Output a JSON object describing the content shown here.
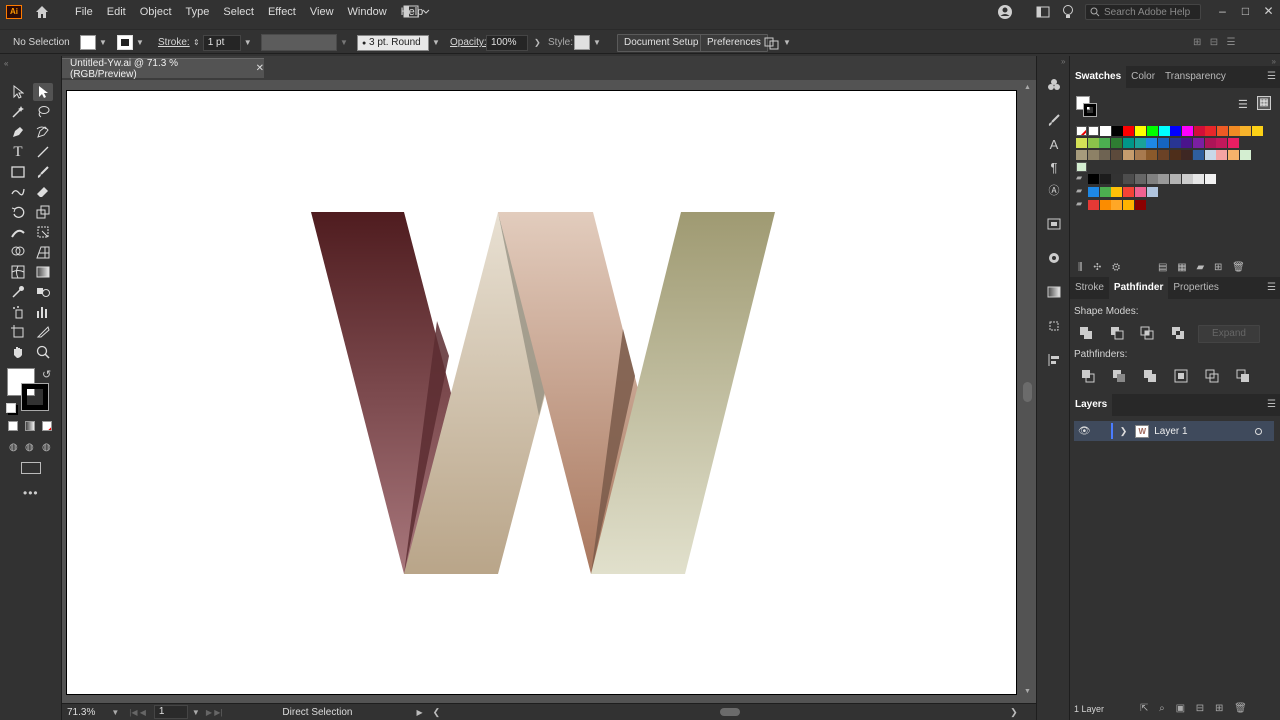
{
  "app": {
    "logo_text": "Ai"
  },
  "menu": {
    "items": [
      "File",
      "Edit",
      "Object",
      "Type",
      "Select",
      "Effect",
      "View",
      "Window",
      "Help"
    ]
  },
  "search": {
    "placeholder": "Search Adobe Help"
  },
  "controlbar": {
    "selection": "No Selection",
    "stroke_label": "Stroke:",
    "stroke_value": "1 pt",
    "brush_value": "3 pt. Round",
    "opacity_label": "Opacity:",
    "opacity_value": "100%",
    "style_label": "Style:",
    "document_setup": "Document Setup",
    "preferences": "Preferences"
  },
  "document": {
    "tab_title": "Untitled-Yw.ai @ 71.3 % (RGB/Preview)",
    "close": "✕"
  },
  "statusbar": {
    "zoom": "71.3%",
    "artboard_num": "1",
    "tool": "Direct Selection"
  },
  "panels": {
    "top_tabs": [
      "Swatches",
      "Color",
      "Transparency"
    ],
    "mid_tabs": [
      "Stroke",
      "Pathfinder",
      "Properties"
    ],
    "shape_modes_label": "Shape Modes:",
    "expand_label": "Expand",
    "pathfinders_label": "Pathfinders:",
    "layers_tab": "Layers",
    "layer_name": "Layer 1",
    "layers_count": "1 Layer"
  },
  "swatch_colors": {
    "row1": [
      "#ffffff",
      "#000000",
      "#ff0000",
      "#ffff00",
      "#00ff00",
      "#00ffff",
      "#0000ff",
      "#ff00ff",
      "#d20f38",
      "#e8262a",
      "#ee5a24",
      "#f08a24",
      "#f7b32b",
      "#fcd116"
    ],
    "row2": [
      "#d4e157",
      "#8bc34a",
      "#4caf50",
      "#2e7d32",
      "#009688",
      "#1aa39a",
      "#1e88e5",
      "#1565c0",
      "#283593",
      "#4a148c",
      "#7b1fa2",
      "#ad1457",
      "#c2185b",
      "#e91e63"
    ],
    "row3": [
      "#a69b7c",
      "#8d8166",
      "#6e6352",
      "#5c4a3b",
      "#c69c6d",
      "#a87a4f",
      "#8b5a2b",
      "#6b4226",
      "#4e2e1a",
      "#3e2723",
      "#2f5e9e",
      "#c8d8e8",
      "#f4a3a3",
      "#f6b26b",
      "#d4eed1"
    ],
    "grays": [
      "#000000",
      "#1c1c1c",
      "#333333",
      "#4d4d4d",
      "#666666",
      "#808080",
      "#999999",
      "#b3b3b3",
      "#cccccc",
      "#e6e6e6",
      "#f2f2f2"
    ],
    "group1": [
      "#1e88e5",
      "#4caf50",
      "#ffc107",
      "#f44336",
      "#f06292",
      "#b0c4de"
    ],
    "group2": [
      "#e53935",
      "#fb8c00",
      "#ffa726",
      "#ffb300",
      "#8b0000"
    ]
  }
}
